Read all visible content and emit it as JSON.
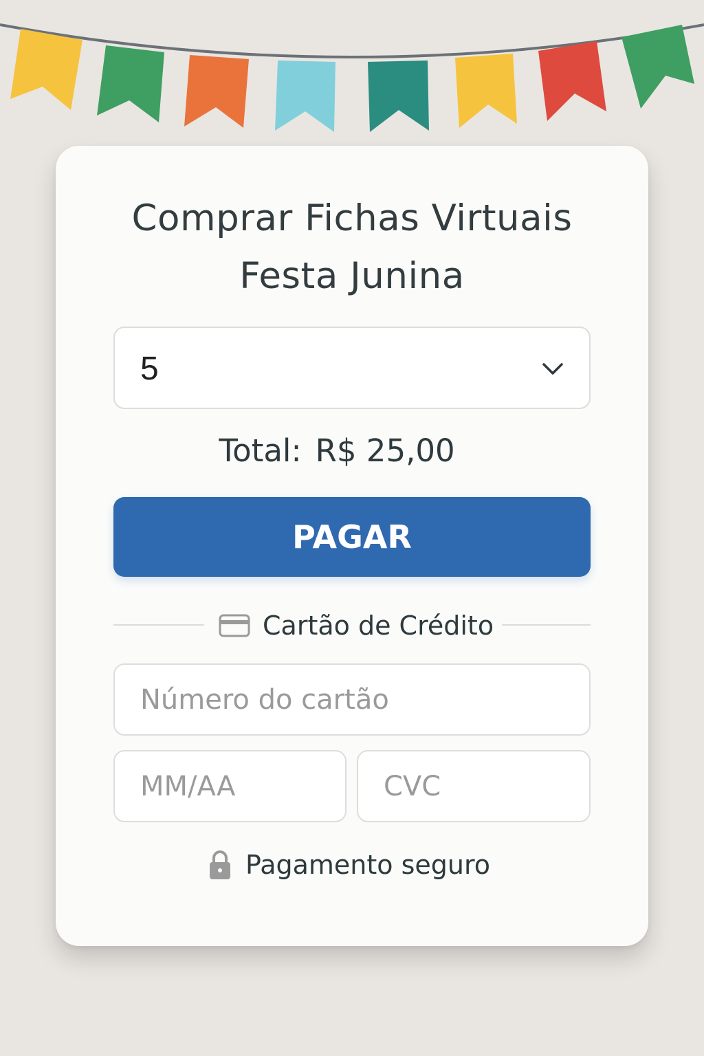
{
  "colors": {
    "background": "#e9e6e1",
    "card": "#fbfbfa",
    "primary_button": "#2f69b0",
    "text_dark": "#2e3a3d",
    "placeholder_text": "#9a9a9a",
    "border": "#dddddd",
    "bunting_flags": [
      "#f6c33f",
      "#3f9e62",
      "#e9733a",
      "#82cfdc",
      "#2b8c80",
      "#f6c33f",
      "#de4a3d",
      "#3f9e62"
    ]
  },
  "decoration": {
    "bunting_icon": "festive-bunting-flags"
  },
  "title": {
    "line1": "Comprar Fichas Virtuais",
    "line2": "Festa Junina"
  },
  "quantity_select": {
    "selected_value": "5",
    "icon": "chevron-down-icon"
  },
  "total": {
    "label": "Total:",
    "amount": "R$ 25,00"
  },
  "pay_button": {
    "label": "PAGAR"
  },
  "payment_method": {
    "label": "Cartão de Crédito",
    "icon": "credit-card-icon"
  },
  "card_form": {
    "number_placeholder": "Número do cartão",
    "expiry_placeholder": "MM/AA",
    "cvc_placeholder": "CVC"
  },
  "secure_note": {
    "label": "Pagamento seguro",
    "icon": "lock-icon"
  }
}
